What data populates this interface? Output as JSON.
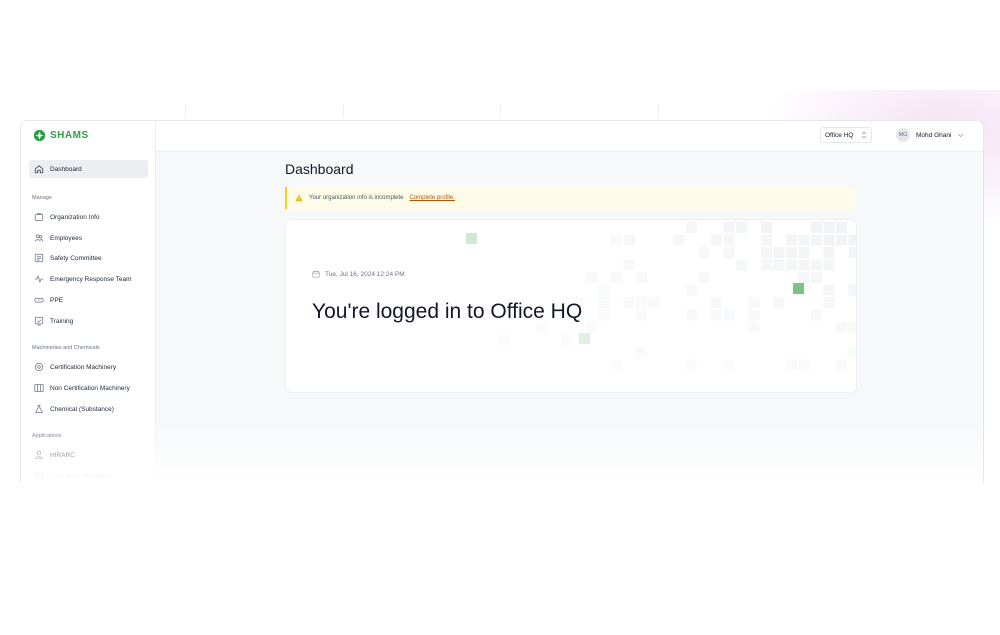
{
  "brand": {
    "name": "SHAMS"
  },
  "sidebar": {
    "active_item": {
      "label": "Dashboard",
      "icon": "home-icon"
    },
    "sections": [
      {
        "label": "Manage",
        "items": [
          {
            "label": "Organization Info",
            "icon": "building-icon"
          },
          {
            "label": "Employees",
            "icon": "users-icon"
          },
          {
            "label": "Safety Committee",
            "icon": "committee-icon"
          },
          {
            "label": "Emergency Response Team",
            "icon": "pulse-icon"
          },
          {
            "label": "PPE",
            "icon": "goggles-icon"
          },
          {
            "label": "Training",
            "icon": "training-icon"
          }
        ]
      },
      {
        "label": "Machineries and Chemicals",
        "items": [
          {
            "label": "Certification Machinery",
            "icon": "gear-icon"
          },
          {
            "label": "Non Certification Machinery",
            "icon": "columns-icon"
          },
          {
            "label": "Chemical (Substance)",
            "icon": "flask-icon"
          }
        ]
      },
      {
        "label": "Applications",
        "items": [
          {
            "label": "HIRARC",
            "icon": "person-icon"
          },
          {
            "label": "Safe Work Procedure",
            "icon": "document-icon"
          }
        ]
      }
    ]
  },
  "topbar": {
    "org_select": {
      "value": "Office HQ"
    },
    "user": {
      "initials": "MG",
      "name": "Mohd Ghani"
    }
  },
  "main": {
    "title": "Dashboard",
    "alert": {
      "text": "Your organization info is incomplete",
      "link": "Complete profile."
    },
    "welcome": {
      "date": "Tue, Jul 16, 2024 12:24 PM",
      "message": "You're logged in to Office HQ"
    }
  },
  "colors": {
    "brand_green": "#2f9e4a",
    "accent_square": "#7dc28a",
    "warning_yellow": "#facc15",
    "link_amber": "#b45309"
  }
}
